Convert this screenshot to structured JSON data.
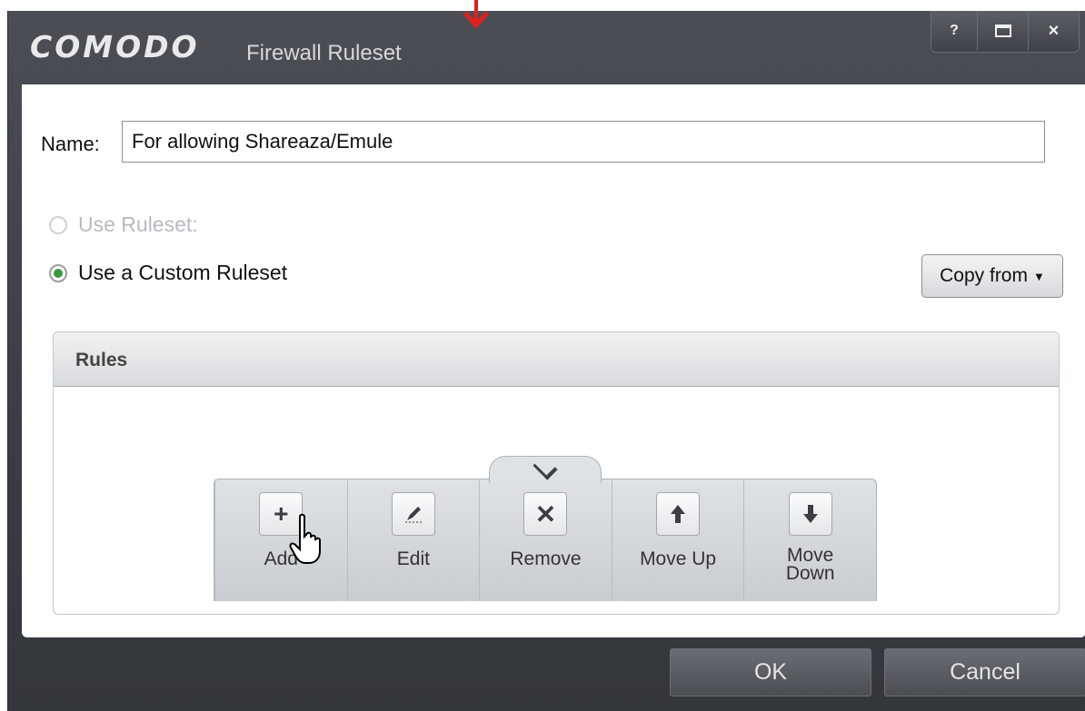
{
  "window": {
    "brand": "COMODO",
    "title": "Firewall Ruleset",
    "help_label": "?",
    "close_label": "×"
  },
  "form": {
    "name_label": "Name:",
    "name_value": "For allowing Shareaza/Emule",
    "use_ruleset_label": "Use Ruleset:",
    "use_custom_label": "Use a Custom Ruleset",
    "use_custom_selected": true,
    "copy_from_label": "Copy from"
  },
  "rules": {
    "header": "Rules",
    "toolbar": [
      {
        "label": "Add",
        "icon": "plus-icon"
      },
      {
        "label": "Edit",
        "icon": "pencil-icon"
      },
      {
        "label": "Remove",
        "icon": "x-icon"
      },
      {
        "label": "Move Up",
        "icon": "arrow-up-icon"
      },
      {
        "label": "Move Down",
        "icon": "arrow-down-icon"
      }
    ]
  },
  "footer": {
    "ok_label": "OK",
    "cancel_label": "Cancel"
  },
  "colors": {
    "titlebar": "#3a3d42",
    "radio_selected": "#3a9a3a",
    "annotation_arrow": "#e31e1e"
  }
}
